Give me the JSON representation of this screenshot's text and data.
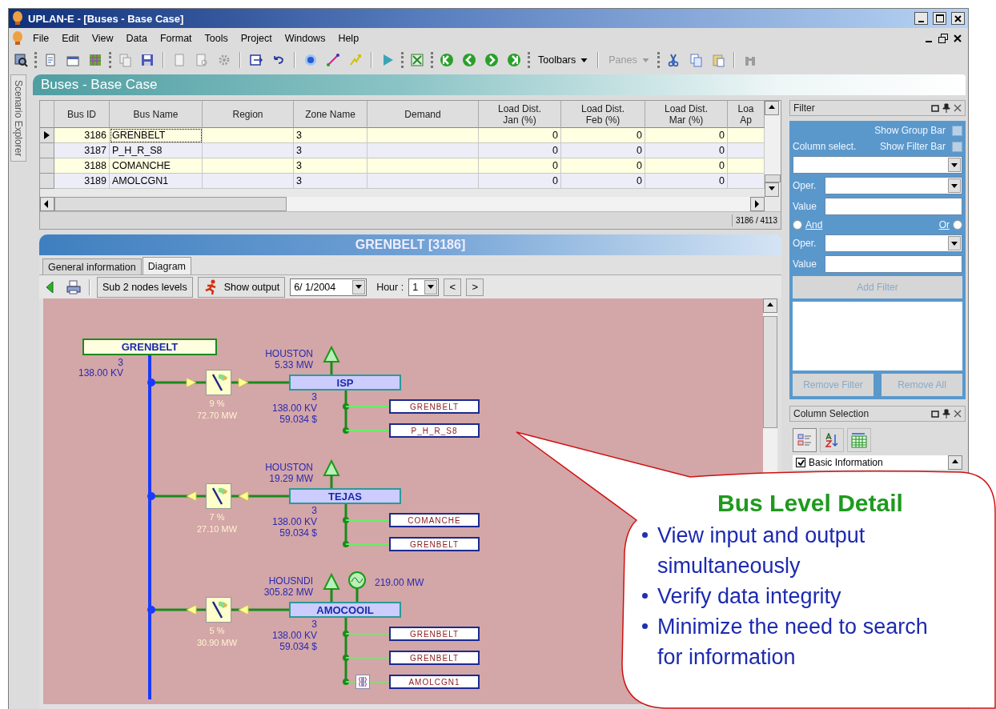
{
  "window": {
    "title": "UPLAN-E - [Buses - Base Case]"
  },
  "menu": [
    "File",
    "Edit",
    "View",
    "Data",
    "Format",
    "Tools",
    "Project",
    "Windows",
    "Help"
  ],
  "toolbar": {
    "buttons": [
      {
        "label": "Toolbars",
        "disabled": false
      },
      {
        "label": "Panes",
        "disabled": true
      }
    ]
  },
  "side_tab": "Scenario Explorer",
  "document_title": "Buses - Base Case",
  "grid": {
    "columns": [
      {
        "kind": "indicator"
      },
      {
        "label": "Bus ID",
        "kind": "number"
      },
      {
        "label": "Bus Name",
        "kind": "text"
      },
      {
        "label": "Region",
        "kind": "text"
      },
      {
        "label": "Zone Name",
        "kind": "text"
      },
      {
        "label": "Demand",
        "kind": "text"
      },
      {
        "label": "Load Dist.\nJan (%)",
        "kind": "number"
      },
      {
        "label": "Load Dist.\nFeb (%)",
        "kind": "number"
      },
      {
        "label": "Load Dist.\nMar (%)",
        "kind": "number"
      },
      {
        "label": "Loa\nAp",
        "kind": "number"
      }
    ],
    "rows": [
      {
        "selected": true,
        "cells": [
          "3186",
          "GRENBELT",
          null,
          "3",
          null,
          "0",
          "0",
          "0",
          null
        ]
      },
      {
        "selected": false,
        "cells": [
          "3187",
          "P_H_R_S8",
          null,
          "3",
          null,
          "0",
          "0",
          "0",
          null
        ]
      },
      {
        "selected": false,
        "cells": [
          "3188",
          "COMANCHE",
          null,
          "3",
          null,
          "0",
          "0",
          "0",
          null
        ]
      },
      {
        "selected": false,
        "cells": [
          "3189",
          "AMOLCGN1",
          null,
          "3",
          null,
          "0",
          "0",
          "0",
          null
        ]
      }
    ],
    "record_counter": "3186 / 4113"
  },
  "detail": {
    "title": "GRENBELT [3186]",
    "tabs": [
      {
        "label": "General information",
        "selected": false
      },
      {
        "label": "Diagram",
        "selected": true
      }
    ],
    "toolbar": {
      "levels_button": "Sub 2 nodes levels",
      "output_button": "Show output",
      "date": "6/ 1/2004",
      "hour_label": "Hour :",
      "hour": "1",
      "prev": "<",
      "next": ">"
    },
    "diagram": {
      "root": {
        "name": "GRENBELT",
        "zone": "3",
        "voltage": "138.00 KV"
      },
      "branches": [
        {
          "bus": "ISP",
          "area": "HOUSTON",
          "load": "5.33 MW",
          "zone": "3",
          "voltage": "138.00 KV",
          "price": "59.034 $",
          "flow_percent": "9 %",
          "flow": "72.70 MW",
          "flow_inward": false,
          "connections": [
            {
              "name": "GRENBELT",
              "kind": "line"
            },
            {
              "name": "P_H_R_S8",
              "kind": "line"
            }
          ]
        },
        {
          "bus": "TEJAS",
          "area": "HOUSTON",
          "load": "19.29 MW",
          "zone": "3",
          "voltage": "138.00 KV",
          "price": "59.034 $",
          "flow_percent": "7 %",
          "flow": "27.10 MW",
          "flow_inward": true,
          "connections": [
            {
              "name": "COMANCHE",
              "kind": "line"
            },
            {
              "name": "GRENBELT",
              "kind": "line"
            }
          ]
        },
        {
          "bus": "AMOCOOIL",
          "area": "HOUSNDI",
          "load": "305.82 MW",
          "generation": "219.00 MW",
          "zone": "3",
          "voltage": "138.00 KV",
          "price": "59.034 $",
          "flow_percent": "5 %",
          "flow": "30.90 MW",
          "flow_inward": true,
          "connections": [
            {
              "name": "GRENBELT",
              "kind": "line"
            },
            {
              "name": "GRENBELT",
              "kind": "line"
            },
            {
              "name": "AMOLCGN1",
              "kind": "transformer"
            }
          ]
        }
      ]
    }
  },
  "filter": {
    "title": "Filter",
    "options": [
      {
        "label": "Show Group Bar",
        "checked": false
      },
      {
        "label": "Show Filter Bar",
        "checked": false
      }
    ],
    "column_select_label": "Column select.",
    "clauses": [
      {
        "oper_label": "Oper.",
        "value_label": "Value"
      },
      {
        "oper_label": "Oper.",
        "value_label": "Value"
      }
    ],
    "joins": [
      {
        "label": "And",
        "selected": false
      },
      {
        "label": "Or",
        "selected": false
      }
    ],
    "add_button": {
      "label": "Add Filter",
      "disabled": true
    },
    "remove_buttons": [
      {
        "label": "Remove Filter",
        "disabled": true
      },
      {
        "label": "Remove All",
        "disabled": true
      }
    ]
  },
  "column_selection": {
    "title": "Column Selection",
    "items": [
      {
        "label": "Basic Information",
        "checked": true
      }
    ]
  },
  "callout": {
    "title": "Bus Level Detail",
    "points": [
      "View input and output simultaneously",
      "Verify data integrity",
      "Minimize the need to search for information"
    ]
  }
}
